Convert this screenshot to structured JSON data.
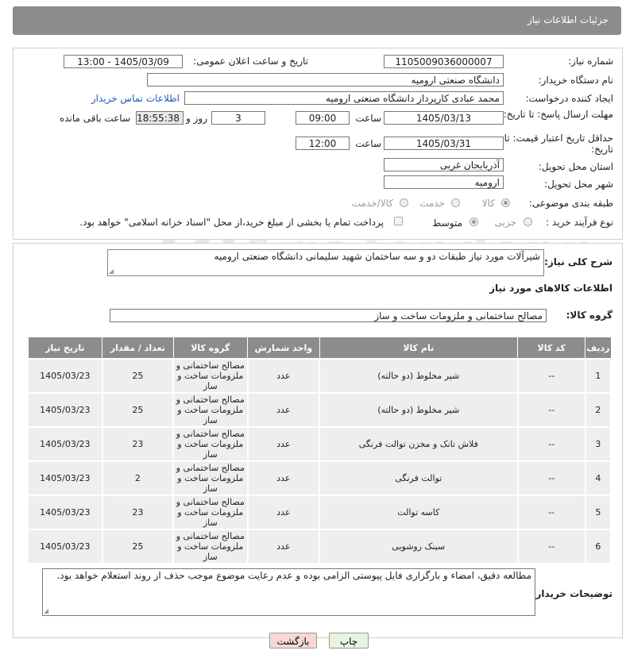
{
  "header": {
    "title": "جزئیات اطلاعات نیاز"
  },
  "form": {
    "need_number_label": "شماره نیاز:",
    "need_number": "1105009036000007",
    "announce_label": "تاریخ و ساعت اعلان عمومی:",
    "announce_value": "1405/03/09 - 13:00",
    "buyer_org_label": "نام دستگاه خریدار:",
    "buyer_org": "دانشگاه صنعتی ارومیه",
    "creator_label": "ایجاد کننده درخواست:",
    "creator": "محمد عبادی کارپرداز دانشگاه صنعتی ارومیه",
    "contact_link": "اطلاعات تماس خریدار",
    "reply_deadline_label": "مهلت ارسال پاسخ: تا تاریخ:",
    "reply_date": "1405/03/13",
    "time_label": "ساعت",
    "reply_time": "09:00",
    "days_value": "3",
    "days_label": "روز و",
    "remaining_time": "18:55:38",
    "remaining_label": "ساعت باقی مانده",
    "price_validity_label": "حداقل تاریخ اعتبار قیمت: تا تاریخ:",
    "validity_date": "1405/03/31",
    "validity_time": "12:00",
    "province_label": "استان محل تحویل:",
    "province": "آذربایجان غربی",
    "city_label": "شهر محل تحویل:",
    "city": "ارومیه",
    "category_label": "طبقه بندی موضوعی:",
    "category_options": [
      "کالا",
      "خدمت",
      "کالا/خدمت"
    ],
    "process_label": "نوع فرآیند خرید :",
    "process_options": [
      "جزیی",
      "متوسط"
    ],
    "payment_note": "پرداخت تمام یا بخشی از مبلغ خرید،از محل \"اسناد خزانه اسلامی\" خواهد بود."
  },
  "details": {
    "description_label": "شرح کلی نیاز:",
    "description": "شیرآلات مورد نیاز طبقات دو و سه ساختمان شهید سلیمانی دانشگاه صنعتی ارومیه",
    "items_title": "اطلاعات کالاهای مورد نیاز",
    "group_label": "گروه کالا:",
    "group_value": "مصالح ساختمانی و ملزومات ساخت و ساز"
  },
  "table": {
    "headers": [
      "ردیف",
      "کد کالا",
      "نام کالا",
      "واحد شمارش",
      "گروه کالا",
      "تعداد / مقدار",
      "تاریخ نیاز"
    ],
    "rows": [
      [
        "1",
        "--",
        "شیر مخلوط (دو حالته)",
        "عدد",
        "مصالح ساختمانی و ملزومات ساخت و ساز",
        "25",
        "1405/03/23"
      ],
      [
        "2",
        "--",
        "شیر مخلوط (دو حالته)",
        "عدد",
        "مصالح ساختمانی و ملزومات ساخت و ساز",
        "25",
        "1405/03/23"
      ],
      [
        "3",
        "--",
        "فلاش تانک و مخزن توالت فرنگی",
        "عدد",
        "مصالح ساختمانی و ملزومات ساخت و ساز",
        "23",
        "1405/03/23"
      ],
      [
        "4",
        "--",
        "توالت فرنگی",
        "عدد",
        "مصالح ساختمانی و ملزومات ساخت و ساز",
        "2",
        "1405/03/23"
      ],
      [
        "5",
        "--",
        "کاسه توالت",
        "عدد",
        "مصالح ساختمانی و ملزومات ساخت و ساز",
        "23",
        "1405/03/23"
      ],
      [
        "6",
        "--",
        "سینک روشویی",
        "عدد",
        "مصالح ساختمانی و ملزومات ساخت و ساز",
        "25",
        "1405/03/23"
      ]
    ]
  },
  "buyer_notes": {
    "label": "توضیحات خریدار:",
    "text": "مطالعه دقیق، امضاء و بارگزاری فایل پیوستی الزامی بوده و عدم رعایت موضوع موجب حذف از روند استعلام خواهد بود."
  },
  "buttons": {
    "print": "چاپ",
    "back": "بازگشت"
  },
  "watermark": {
    "text": "AriaTender.net"
  },
  "colors": {
    "header_bg": "#8c8c8c",
    "link": "#1a5fb4",
    "back_button": "#f8d7d7",
    "print_button": "#e6f5e0"
  }
}
